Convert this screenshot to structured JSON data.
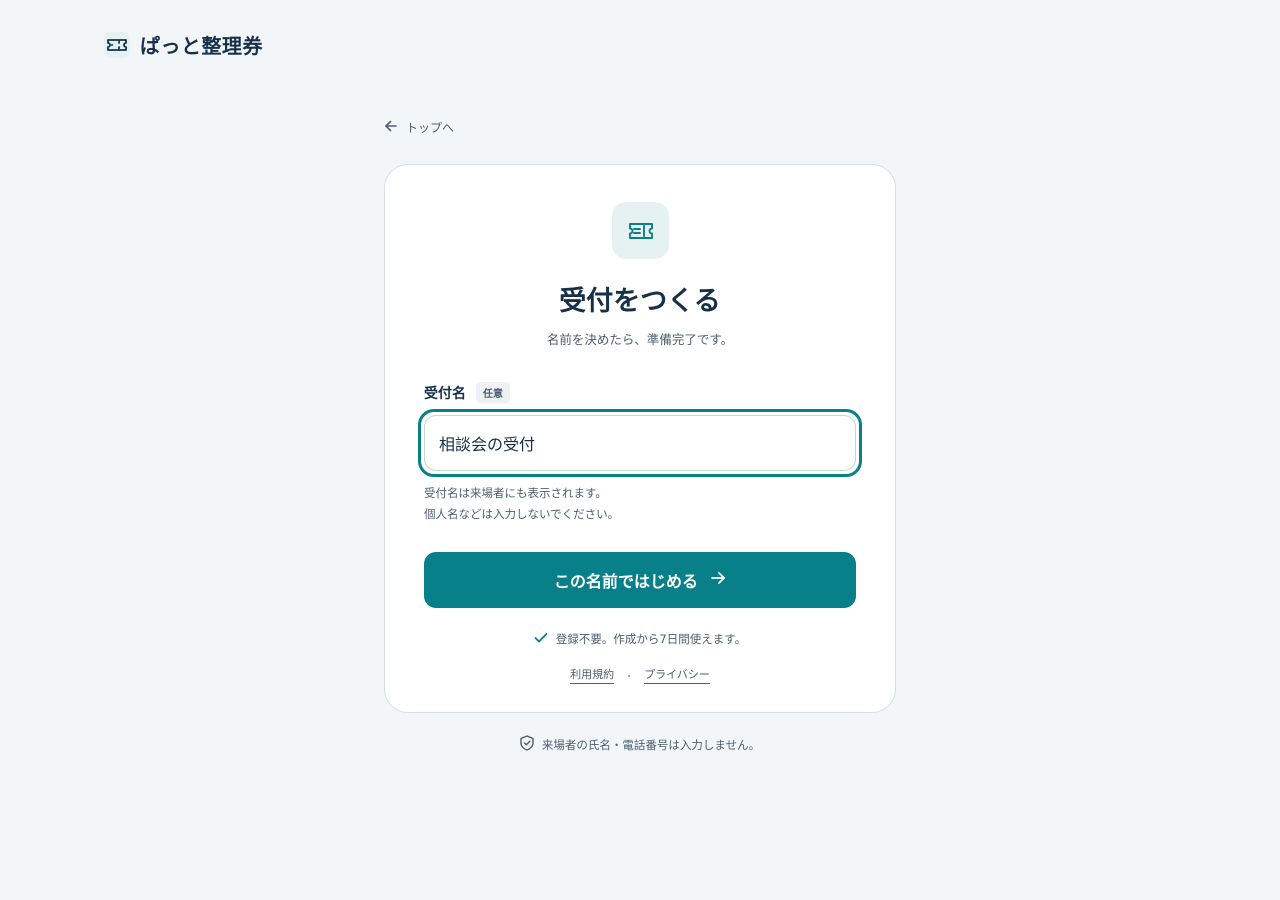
{
  "brand": {
    "name": "ぱっと整理券",
    "icon": "ticket-icon",
    "accent_color": "#07808a"
  },
  "nav": {
    "back_label": "トップへ",
    "back_icon": "arrow-left-icon"
  },
  "card": {
    "icon": "ticket-icon",
    "title": "受付をつくる",
    "subtitle": "名前を決めたら、準備完了です。",
    "field": {
      "label": "受付名",
      "badge": "任意",
      "value": "相談会の受付",
      "help_line1": "受付名は来場者にも表示されます。",
      "help_line2": "個人名などは入力しないでください。"
    },
    "submit": {
      "label": "この名前ではじめる",
      "icon": "arrow-right-icon"
    },
    "note": {
      "icon": "check-icon",
      "text": "登録不要。作成から7日間使えます。"
    },
    "links": {
      "terms": "利用規約",
      "separator": "・",
      "privacy": "プライバシー"
    }
  },
  "footer": {
    "icon": "shield-check-icon",
    "text": "来場者の氏名・電話番号は入力しません。"
  }
}
